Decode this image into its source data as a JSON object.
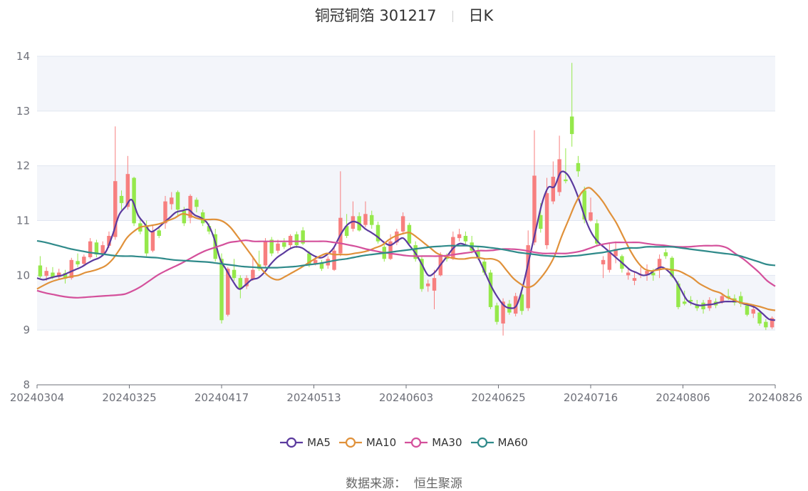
{
  "header": {
    "stock": "铜冠铜箔 301217",
    "period": "日K"
  },
  "source": {
    "label": "数据来源：",
    "value": "恒生聚源"
  },
  "colors": {
    "up": "#f77f7f",
    "down": "#95e84b",
    "band": "#f3f5fa",
    "grid": "#e0e6f1",
    "axis": "#6e7079"
  },
  "chart_data": {
    "type": "candlestick",
    "title": "铜冠铜箔 301217 日K",
    "ylim": [
      8,
      14
    ],
    "yticks": [
      8,
      9,
      10,
      11,
      12,
      13,
      14
    ],
    "xticks": [
      "20240304",
      "20240325",
      "20240417",
      "20240513",
      "20240603",
      "20240625",
      "20240716",
      "20240806",
      "20240826"
    ],
    "x_first": "20240304",
    "x_last": "20240826",
    "candles": [
      {
        "o": 10.18,
        "c": 9.98,
        "h": 10.35,
        "l": 9.95
      },
      {
        "o": 9.99,
        "c": 10.08,
        "h": 10.15,
        "l": 9.9
      },
      {
        "o": 10.05,
        "c": 9.96,
        "h": 10.15,
        "l": 9.93
      },
      {
        "o": 9.97,
        "c": 10.05,
        "h": 10.12,
        "l": 9.94
      },
      {
        "o": 10.04,
        "c": 9.94,
        "h": 10.1,
        "l": 9.85
      },
      {
        "o": 9.95,
        "c": 10.28,
        "h": 10.32,
        "l": 9.92
      },
      {
        "o": 10.26,
        "c": 10.2,
        "h": 10.4,
        "l": 10.15
      },
      {
        "o": 10.21,
        "c": 10.34,
        "h": 10.38,
        "l": 10.18
      },
      {
        "o": 10.33,
        "c": 10.62,
        "h": 10.68,
        "l": 10.3
      },
      {
        "o": 10.6,
        "c": 10.38,
        "h": 10.65,
        "l": 10.33
      },
      {
        "o": 10.39,
        "c": 10.55,
        "h": 10.62,
        "l": 10.35
      },
      {
        "o": 10.54,
        "c": 10.72,
        "h": 10.8,
        "l": 10.5
      },
      {
        "o": 10.7,
        "c": 11.72,
        "h": 12.72,
        "l": 10.65
      },
      {
        "o": 11.45,
        "c": 11.32,
        "h": 11.55,
        "l": 11.2
      },
      {
        "o": 11.25,
        "c": 11.85,
        "h": 12.18,
        "l": 11.2
      },
      {
        "o": 11.78,
        "c": 10.95,
        "h": 11.8,
        "l": 10.9
      },
      {
        "o": 10.95,
        "c": 10.8,
        "h": 11.05,
        "l": 10.75
      },
      {
        "o": 10.9,
        "c": 10.4,
        "h": 11.0,
        "l": 10.35
      },
      {
        "o": 10.45,
        "c": 10.8,
        "h": 10.92,
        "l": 10.42
      },
      {
        "o": 10.82,
        "c": 10.72,
        "h": 10.9,
        "l": 10.68
      },
      {
        "o": 10.95,
        "c": 11.35,
        "h": 11.45,
        "l": 10.85
      },
      {
        "o": 11.3,
        "c": 11.42,
        "h": 11.52,
        "l": 11.2
      },
      {
        "o": 11.52,
        "c": 11.2,
        "h": 11.55,
        "l": 11.1
      },
      {
        "o": 11.18,
        "c": 10.95,
        "h": 11.25,
        "l": 10.9
      },
      {
        "o": 11.05,
        "c": 11.45,
        "h": 11.48,
        "l": 10.95
      },
      {
        "o": 11.38,
        "c": 11.25,
        "h": 11.42,
        "l": 11.15
      },
      {
        "o": 11.15,
        "c": 10.95,
        "h": 11.2,
        "l": 10.9
      },
      {
        "o": 10.9,
        "c": 10.8,
        "h": 10.95,
        "l": 10.75
      },
      {
        "o": 10.75,
        "c": 10.3,
        "h": 10.85,
        "l": 10.25
      },
      {
        "o": 10.3,
        "c": 9.18,
        "h": 10.4,
        "l": 9.12
      },
      {
        "o": 9.28,
        "c": 10.12,
        "h": 10.15,
        "l": 9.25
      },
      {
        "o": 10.1,
        "c": 9.95,
        "h": 10.3,
        "l": 9.9
      },
      {
        "o": 9.95,
        "c": 9.75,
        "h": 10.0,
        "l": 9.58
      },
      {
        "o": 9.8,
        "c": 9.95,
        "h": 10.0,
        "l": 9.75
      },
      {
        "o": 9.92,
        "c": 10.1,
        "h": 10.35,
        "l": 9.9
      },
      {
        "o": 10.2,
        "c": 10.12,
        "h": 10.45,
        "l": 10.08
      },
      {
        "o": 10.18,
        "c": 10.62,
        "h": 10.68,
        "l": 10.15
      },
      {
        "o": 10.65,
        "c": 10.4,
        "h": 10.7,
        "l": 10.35
      },
      {
        "o": 10.45,
        "c": 10.58,
        "h": 10.65,
        "l": 10.4
      },
      {
        "o": 10.6,
        "c": 10.52,
        "h": 10.68,
        "l": 10.48
      },
      {
        "o": 10.55,
        "c": 10.72,
        "h": 10.75,
        "l": 10.5
      },
      {
        "o": 10.75,
        "c": 10.55,
        "h": 10.8,
        "l": 10.5
      },
      {
        "o": 10.82,
        "c": 10.58,
        "h": 10.88,
        "l": 10.55
      },
      {
        "o": 10.4,
        "c": 10.2,
        "h": 10.45,
        "l": 10.15
      },
      {
        "o": 10.22,
        "c": 10.28,
        "h": 10.35,
        "l": 10.18
      },
      {
        "o": 10.22,
        "c": 10.12,
        "h": 10.28,
        "l": 10.08
      },
      {
        "o": 10.18,
        "c": 10.3,
        "h": 10.35,
        "l": 10.12
      },
      {
        "o": 10.1,
        "c": 10.45,
        "h": 10.52,
        "l": 10.08
      },
      {
        "o": 10.4,
        "c": 11.05,
        "h": 11.9,
        "l": 10.35
      },
      {
        "o": 10.9,
        "c": 10.72,
        "h": 11.12,
        "l": 10.68
      },
      {
        "o": 10.85,
        "c": 11.08,
        "h": 11.35,
        "l": 10.8
      },
      {
        "o": 11.08,
        "c": 10.82,
        "h": 11.15,
        "l": 10.8
      },
      {
        "o": 10.92,
        "c": 11.12,
        "h": 11.35,
        "l": 10.88
      },
      {
        "o": 11.1,
        "c": 10.92,
        "h": 11.18,
        "l": 10.85
      },
      {
        "o": 10.92,
        "c": 10.62,
        "h": 10.98,
        "l": 10.58
      },
      {
        "o": 10.52,
        "c": 10.3,
        "h": 10.58,
        "l": 10.25
      },
      {
        "o": 10.3,
        "c": 10.62,
        "h": 10.75,
        "l": 10.28
      },
      {
        "o": 10.6,
        "c": 10.8,
        "h": 10.85,
        "l": 10.55
      },
      {
        "o": 10.8,
        "c": 11.08,
        "h": 11.15,
        "l": 10.75
      },
      {
        "o": 10.92,
        "c": 10.58,
        "h": 10.96,
        "l": 10.55
      },
      {
        "o": 10.55,
        "c": 10.3,
        "h": 10.62,
        "l": 10.25
      },
      {
        "o": 10.3,
        "c": 9.75,
        "h": 10.35,
        "l": 9.7
      },
      {
        "o": 9.8,
        "c": 9.85,
        "h": 9.92,
        "l": 9.7
      },
      {
        "o": 9.72,
        "c": 9.95,
        "h": 10.1,
        "l": 9.38
      },
      {
        "o": 10.0,
        "c": 10.35,
        "h": 10.42,
        "l": 9.98
      },
      {
        "o": 10.32,
        "c": 10.3,
        "h": 10.4,
        "l": 10.25
      },
      {
        "o": 10.3,
        "c": 10.7,
        "h": 10.8,
        "l": 10.28
      },
      {
        "o": 10.68,
        "c": 10.75,
        "h": 10.85,
        "l": 10.62
      },
      {
        "o": 10.72,
        "c": 10.62,
        "h": 10.8,
        "l": 10.55
      },
      {
        "o": 10.6,
        "c": 10.45,
        "h": 10.72,
        "l": 10.4
      },
      {
        "o": 10.45,
        "c": 10.32,
        "h": 10.52,
        "l": 10.28
      },
      {
        "o": 10.25,
        "c": 10.05,
        "h": 10.3,
        "l": 10.0
      },
      {
        "o": 10.05,
        "c": 9.42,
        "h": 10.1,
        "l": 9.38
      },
      {
        "o": 9.45,
        "c": 9.15,
        "h": 9.5,
        "l": 9.1
      },
      {
        "o": 9.12,
        "c": 9.52,
        "h": 9.58,
        "l": 8.9
      },
      {
        "o": 9.48,
        "c": 9.32,
        "h": 9.55,
        "l": 9.28
      },
      {
        "o": 9.3,
        "c": 9.62,
        "h": 9.68,
        "l": 9.25
      },
      {
        "o": 9.65,
        "c": 9.35,
        "h": 9.72,
        "l": 9.28
      },
      {
        "o": 9.4,
        "c": 10.55,
        "h": 10.82,
        "l": 9.35
      },
      {
        "o": 10.6,
        "c": 11.82,
        "h": 12.65,
        "l": 10.55
      },
      {
        "o": 11.1,
        "c": 10.85,
        "h": 11.32,
        "l": 10.78
      },
      {
        "o": 10.55,
        "c": 11.5,
        "h": 11.78,
        "l": 10.48
      },
      {
        "o": 11.35,
        "c": 11.8,
        "h": 12.08,
        "l": 11.3
      },
      {
        "o": 11.52,
        "c": 12.12,
        "h": 12.55,
        "l": 11.45
      },
      {
        "o": 11.75,
        "c": 11.72,
        "h": 12.32,
        "l": 11.68
      },
      {
        "o": 12.9,
        "c": 12.58,
        "h": 13.88,
        "l": 12.35
      },
      {
        "o": 12.05,
        "c": 11.9,
        "h": 12.18,
        "l": 11.8
      },
      {
        "o": 11.55,
        "c": 11.02,
        "h": 11.62,
        "l": 10.95
      },
      {
        "o": 11.0,
        "c": 11.15,
        "h": 11.42,
        "l": 10.98
      },
      {
        "o": 10.95,
        "c": 10.58,
        "h": 11.02,
        "l": 10.55
      },
      {
        "o": 10.2,
        "c": 10.28,
        "h": 10.35,
        "l": 9.95
      },
      {
        "o": 10.1,
        "c": 10.42,
        "h": 10.6,
        "l": 10.05
      },
      {
        "o": 10.35,
        "c": 10.48,
        "h": 10.62,
        "l": 10.22
      },
      {
        "o": 10.35,
        "c": 10.12,
        "h": 10.38,
        "l": 10.05
      },
      {
        "o": 10.0,
        "c": 10.05,
        "h": 10.12,
        "l": 9.92
      },
      {
        "o": 9.9,
        "c": 9.95,
        "h": 10.05,
        "l": 9.82
      },
      {
        "o": 10.0,
        "c": 10.02,
        "h": 10.15,
        "l": 9.95
      },
      {
        "o": 10.02,
        "c": 10.08,
        "h": 10.2,
        "l": 9.9
      },
      {
        "o": 10.05,
        "c": 10.0,
        "h": 10.12,
        "l": 9.9
      },
      {
        "o": 10.1,
        "c": 10.3,
        "h": 10.38,
        "l": 9.95
      },
      {
        "o": 10.42,
        "c": 10.35,
        "h": 10.48,
        "l": 10.3
      },
      {
        "o": 10.32,
        "c": 9.98,
        "h": 10.35,
        "l": 9.95
      },
      {
        "o": 9.85,
        "c": 9.42,
        "h": 9.9,
        "l": 9.38
      },
      {
        "o": 9.52,
        "c": 9.48,
        "h": 9.72,
        "l": 9.45
      },
      {
        "o": 9.55,
        "c": 9.52,
        "h": 9.62,
        "l": 9.45
      },
      {
        "o": 9.45,
        "c": 9.4,
        "h": 9.55,
        "l": 9.35
      },
      {
        "o": 9.5,
        "c": 9.38,
        "h": 9.55,
        "l": 9.3
      },
      {
        "o": 9.4,
        "c": 9.55,
        "h": 9.6,
        "l": 9.35
      },
      {
        "o": 9.52,
        "c": 9.45,
        "h": 9.58,
        "l": 9.4
      },
      {
        "o": 9.52,
        "c": 9.62,
        "h": 9.68,
        "l": 9.48
      },
      {
        "o": 9.62,
        "c": 9.58,
        "h": 9.75,
        "l": 9.55
      },
      {
        "o": 9.58,
        "c": 9.5,
        "h": 9.65,
        "l": 9.45
      },
      {
        "o": 9.62,
        "c": 9.48,
        "h": 9.7,
        "l": 9.42
      },
      {
        "o": 9.45,
        "c": 9.28,
        "h": 9.5,
        "l": 9.25
      },
      {
        "o": 9.3,
        "c": 9.38,
        "h": 9.42,
        "l": 9.22
      },
      {
        "o": 9.32,
        "c": 9.12,
        "h": 9.35,
        "l": 9.08
      },
      {
        "o": 9.15,
        "c": 9.05,
        "h": 9.2,
        "l": 9.0
      },
      {
        "o": 9.05,
        "c": 9.22,
        "h": 9.25,
        "l": 9.02
      }
    ],
    "series": [
      {
        "name": "MA5",
        "color": "#5b3a9e",
        "values": [
          9.95,
          9.92,
          9.95,
          9.98,
          10.0,
          10.05,
          10.1,
          10.15,
          10.22,
          10.28,
          10.33,
          10.45,
          10.75,
          11.1,
          11.25,
          11.38,
          11.1,
          10.95,
          10.8,
          10.85,
          10.95,
          11.05,
          11.15,
          11.18,
          11.2,
          11.1,
          11.05,
          10.95,
          10.7,
          10.3,
          10.1,
          9.9,
          9.75,
          9.82,
          9.92,
          9.95,
          10.05,
          10.2,
          10.32,
          10.4,
          10.48,
          10.52,
          10.5,
          10.42,
          10.35,
          10.32,
          10.38,
          10.5,
          10.72,
          10.9,
          10.98,
          10.95,
          10.85,
          10.78,
          10.7,
          10.6,
          10.55,
          10.62,
          10.68,
          10.55,
          10.4,
          10.2,
          10.0,
          10.05,
          10.2,
          10.35,
          10.5,
          10.58,
          10.55,
          10.5,
          10.3,
          10.05,
          9.8,
          9.6,
          9.45,
          9.4,
          9.45,
          9.8,
          10.3,
          10.8,
          11.3,
          11.6,
          11.62,
          11.88,
          11.85,
          11.65,
          11.35,
          11.0,
          10.75,
          10.6,
          10.5,
          10.4,
          10.3,
          10.2,
          10.1,
          10.05,
          10.0,
          10.02,
          10.1,
          10.15,
          10.08,
          9.95,
          9.75,
          9.55,
          9.48,
          9.45,
          9.46,
          9.47,
          9.5,
          9.52,
          9.52,
          9.52,
          9.48,
          9.45,
          9.4,
          9.3,
          9.2,
          9.18
        ]
      },
      {
        "name": "MA10",
        "color": "#e0913a",
        "values": [
          9.75,
          9.82,
          9.88,
          9.92,
          9.95,
          9.98,
          10.0,
          10.05,
          10.08,
          10.12,
          10.18,
          10.3,
          10.48,
          10.68,
          10.8,
          10.88,
          10.9,
          10.92,
          10.95,
          11.0,
          11.05,
          11.12,
          11.1,
          11.05,
          11.02,
          11.02,
          11.02,
          10.98,
          10.88,
          10.72,
          10.55,
          10.38,
          10.2,
          10.05,
          9.95,
          9.92,
          9.98,
          10.05,
          10.12,
          10.2,
          10.28,
          10.35,
          10.4,
          10.38,
          10.38,
          10.38,
          10.4,
          10.42,
          10.45,
          10.5,
          10.55,
          10.65,
          10.72,
          10.76,
          10.78,
          10.7,
          10.6,
          10.5,
          10.4,
          10.35,
          10.32,
          10.3,
          10.3,
          10.32,
          10.32,
          10.3,
          10.3,
          10.25,
          10.1,
          9.95,
          9.85,
          9.78,
          9.82,
          9.95,
          10.12,
          10.35,
          10.7,
          11.0,
          11.3,
          11.52,
          11.6,
          11.5,
          11.35,
          11.15,
          10.95,
          10.7,
          10.45,
          10.25,
          10.12,
          10.08,
          10.1,
          10.12,
          10.1,
          10.08,
          10.02,
          9.95,
          9.85,
          9.78,
          9.72,
          9.68,
          9.6,
          9.55,
          9.5,
          9.48,
          9.45,
          9.42,
          9.38,
          9.36
        ]
      },
      {
        "name": "MA30",
        "color": "#d4509b",
        "values": [
          9.72,
          9.68,
          9.65,
          9.62,
          9.6,
          9.59,
          9.6,
          9.61,
          9.62,
          9.63,
          9.64,
          9.66,
          9.72,
          9.8,
          9.9,
          10.0,
          10.08,
          10.15,
          10.22,
          10.3,
          10.38,
          10.45,
          10.5,
          10.55,
          10.6,
          10.62,
          10.64,
          10.62,
          10.62,
          10.62,
          10.62,
          10.62,
          10.62,
          10.62,
          10.62,
          10.62,
          10.62,
          10.6,
          10.58,
          10.55,
          10.52,
          10.48,
          10.45,
          10.42,
          10.4,
          10.38,
          10.36,
          10.35,
          10.35,
          10.35,
          10.35,
          10.36,
          10.38,
          10.4,
          10.42,
          10.45,
          10.45,
          10.46,
          10.48,
          10.48,
          10.47,
          10.45,
          10.42,
          10.4,
          10.4,
          10.4,
          10.4,
          10.42,
          10.45,
          10.5,
          10.55,
          10.58,
          10.6,
          10.6,
          10.6,
          10.6,
          10.58,
          10.56,
          10.55,
          10.53,
          10.52,
          10.52,
          10.53,
          10.54,
          10.54,
          10.54,
          10.5,
          10.4,
          10.3,
          10.18,
          10.05,
          9.9,
          9.8
        ]
      },
      {
        "name": "MA60",
        "color": "#2f8a8a",
        "values": [
          10.63,
          10.6,
          10.56,
          10.52,
          10.48,
          10.45,
          10.42,
          10.4,
          10.38,
          10.36,
          10.35,
          10.35,
          10.34,
          10.33,
          10.32,
          10.3,
          10.28,
          10.27,
          10.26,
          10.25,
          10.24,
          10.22,
          10.2,
          10.18,
          10.16,
          10.15,
          10.14,
          10.14,
          10.14,
          10.15,
          10.16,
          10.18,
          10.2,
          10.22,
          10.25,
          10.28,
          10.3,
          10.33,
          10.36,
          10.38,
          10.4,
          10.42,
          10.44,
          10.46,
          10.48,
          10.5,
          10.52,
          10.53,
          10.54,
          10.54,
          10.54,
          10.53,
          10.52,
          10.5,
          10.48,
          10.45,
          10.42,
          10.4,
          10.38,
          10.36,
          10.35,
          10.34,
          10.35,
          10.36,
          10.38,
          10.4,
          10.42,
          10.45,
          10.48,
          10.5,
          10.5,
          10.52,
          10.52,
          10.52,
          10.52,
          10.5,
          10.48,
          10.46,
          10.44,
          10.42,
          10.4,
          10.38,
          10.35,
          10.3,
          10.25,
          10.2,
          10.18
        ]
      }
    ]
  }
}
